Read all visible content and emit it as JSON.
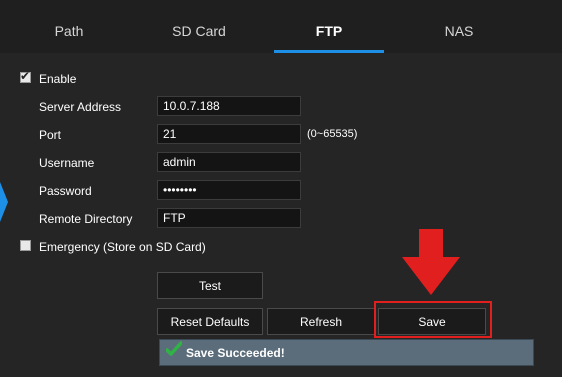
{
  "tabs": [
    {
      "label": "Path",
      "active": false
    },
    {
      "label": "SD Card",
      "active": false
    },
    {
      "label": "FTP",
      "active": true
    },
    {
      "label": "NAS",
      "active": false
    }
  ],
  "form": {
    "enable_label": "Enable",
    "enable_checked": true,
    "server_address_label": "Server Address",
    "server_address_value": "10.0.7.188",
    "port_label": "Port",
    "port_value": "21",
    "port_hint": "(0~65535)",
    "username_label": "Username",
    "username_value": "admin",
    "password_label": "Password",
    "password_value": "••••••••",
    "remote_directory_label": "Remote Directory",
    "remote_directory_value": "FTP",
    "emergency_label": "Emergency (Store on SD Card)",
    "emergency_checked": false
  },
  "buttons": {
    "test": "Test",
    "reset_defaults": "Reset Defaults",
    "refresh": "Refresh",
    "save": "Save"
  },
  "status": {
    "message": "Save Succeeded!",
    "icon": "checkmark-icon"
  },
  "colors": {
    "accent": "#1e8fe6",
    "highlight": "#e21f1f",
    "status_bg": "#5b6d7b",
    "success": "#2fb344"
  }
}
